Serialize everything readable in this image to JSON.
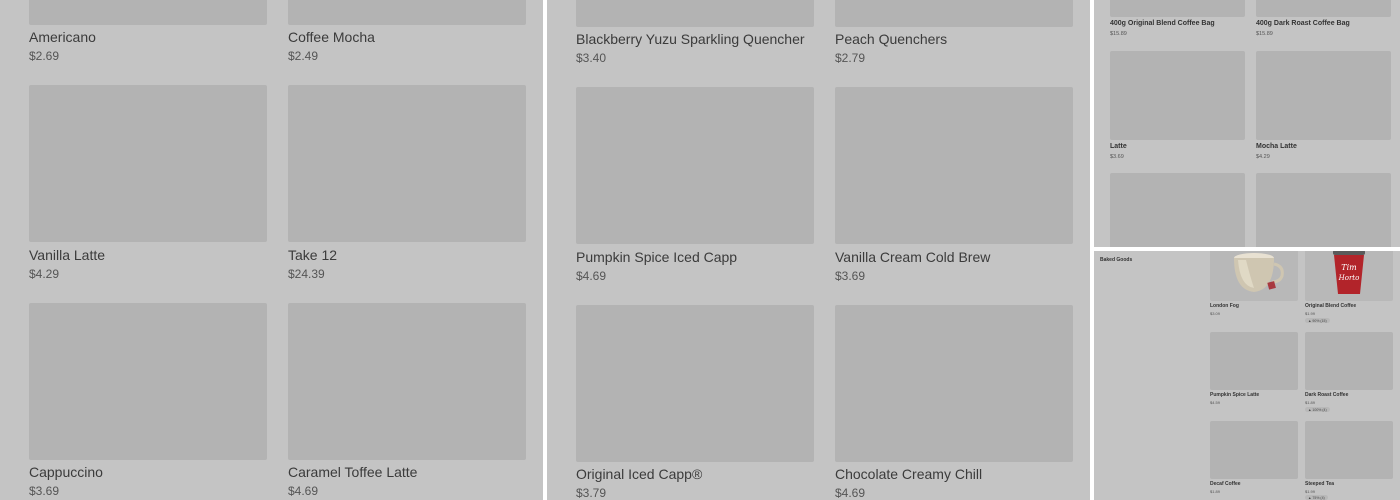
{
  "panel1": {
    "items": [
      {
        "name": "Americano",
        "price": "$2.69"
      },
      {
        "name": "Coffee Mocha",
        "price": "$2.49"
      },
      {
        "name": "Vanilla Latte",
        "price": "$4.29"
      },
      {
        "name": "Take 12",
        "price": "$24.39"
      },
      {
        "name": "Cappuccino",
        "price": "$3.69"
      },
      {
        "name": "Caramel Toffee Latte",
        "price": "$4.69"
      }
    ]
  },
  "panel2": {
    "items": [
      {
        "name": "Blackberry Yuzu Sparkling Quencher",
        "price": "$3.40"
      },
      {
        "name": "Peach Quenchers",
        "price": "$2.79"
      },
      {
        "name": "Pumpkin Spice Iced Capp",
        "price": "$4.69"
      },
      {
        "name": "Vanilla Cream Cold Brew",
        "price": "$3.69"
      },
      {
        "name": "Original Iced Capp®",
        "price": "$3.79"
      },
      {
        "name": "Chocolate Creamy Chill",
        "price": "$4.69"
      }
    ]
  },
  "panel3": {
    "items": [
      {
        "name": "400g Original Blend Coffee Bag",
        "price": "$15.89"
      },
      {
        "name": "400g Dark Roast Coffee Bag",
        "price": "$15.89"
      },
      {
        "name": "Latte",
        "price": "$3.69"
      },
      {
        "name": "Mocha Latte",
        "price": "$4.29"
      }
    ]
  },
  "panel4": {
    "category": "Baked Goods",
    "items": [
      {
        "name": "London Fog",
        "price": "$3.09"
      },
      {
        "name": "Original Blend Coffee",
        "price": "$1.99",
        "badge": "▲ 90% (15)"
      },
      {
        "name": "Pumpkin Spice Latte",
        "price": "$4.59"
      },
      {
        "name": "Dark Roast Coffee",
        "price": "$1.89",
        "badge": "▲ 100% (4)"
      },
      {
        "name": "Decaf Coffee",
        "price": "$1.89"
      },
      {
        "name": "Steeped Tea",
        "price": "$1.99",
        "badge": "▲ 75% (4)"
      }
    ],
    "brand_text": "Tim Hortons"
  }
}
